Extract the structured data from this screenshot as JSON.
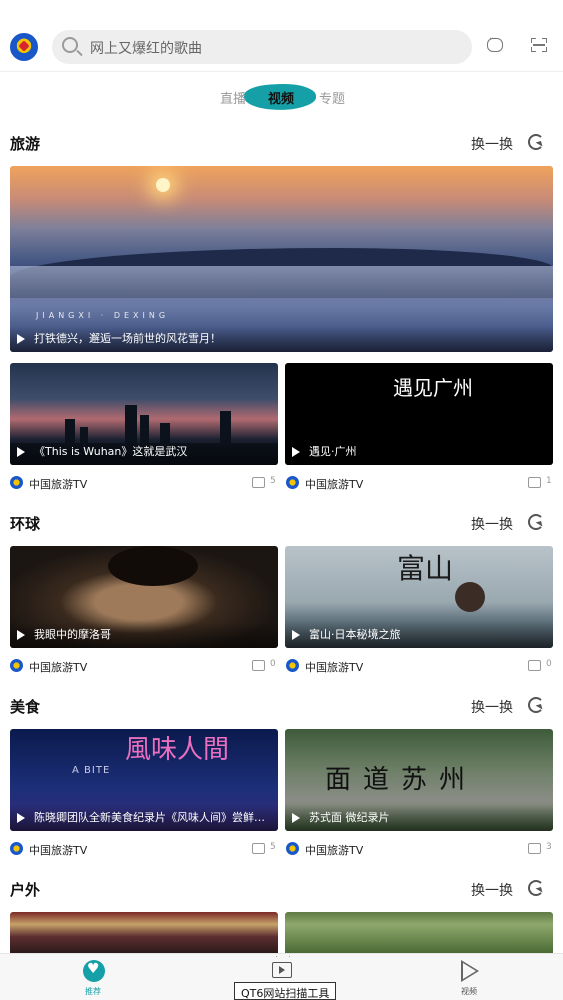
{
  "header": {
    "logo": "cctv-travel-logo",
    "search_placeholder": "网上又爆红的歌曲"
  },
  "tabs": [
    {
      "label": "直播"
    },
    {
      "label": "视频",
      "active": true
    },
    {
      "label": "专题"
    }
  ],
  "accent_color": "#14a0a6",
  "refresh_label": "换一换",
  "sections": [
    {
      "title": "旅游",
      "hero": {
        "title": "打铁德兴，邂逅一场前世的风花雪月！",
        "watermark": "JIANGXI · DEXING"
      },
      "cards": [
        {
          "title": "《This is Wuhan》这就是武汉",
          "channel": "中国旅游TV",
          "comments": "5"
        },
        {
          "title": "遇见·广州",
          "channel": "中国旅游TV",
          "comments": "1",
          "art_text": "遇见广州"
        }
      ]
    },
    {
      "title": "环球",
      "cards": [
        {
          "title": "我眼中的摩洛哥",
          "channel": "中国旅游TV",
          "comments": "0"
        },
        {
          "title": "富山·日本秘境之旅",
          "channel": "中国旅游TV",
          "comments": "0",
          "art_text": "富山"
        }
      ]
    },
    {
      "title": "美食",
      "cards": [
        {
          "title": "陈晓卿团队全新美食纪录片《风味人间》尝鲜版...",
          "channel": "中国旅游TV",
          "comments": "5",
          "art_text": "風味人間",
          "art_sub": "A BITE"
        },
        {
          "title": "苏式面 微纪录片",
          "channel": "中国旅游TV",
          "comments": "3",
          "art_text": "面道苏州"
        }
      ]
    },
    {
      "title": "户外",
      "cards": [
        {
          "title": ""
        },
        {
          "title": ""
        }
      ]
    }
  ],
  "bottom_nav": [
    {
      "label": "推荐",
      "icon": "heart-icon",
      "active": true
    },
    {
      "label": "",
      "icon": "tv-icon"
    },
    {
      "label": "视频",
      "icon": "play-icon"
    }
  ],
  "tooltip": "QT6网站扫描工具"
}
